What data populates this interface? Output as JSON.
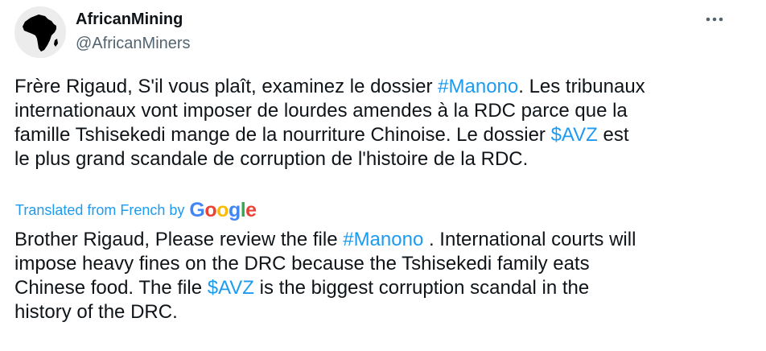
{
  "author": {
    "display_name": "AfricanMining",
    "handle": "@AfricanMiners",
    "avatar_icon": "africa-map-icon"
  },
  "more_menu_icon": "more-options-icon",
  "tweet": {
    "lines": [
      [
        {
          "text": "Frère Rigaud, S'il vous plaît, examinez le dossier ",
          "link": false
        },
        {
          "text": "#Manono",
          "link": true
        },
        {
          "text": ". Les tribunaux",
          "link": false
        }
      ],
      [
        {
          "text": "internationaux vont imposer de lourdes amendes à la RDC parce que la",
          "link": false
        }
      ],
      [
        {
          "text": "famille Tshisekedi mange de la nourriture Chinoise. Le dossier ",
          "link": false
        },
        {
          "text": "$AVZ",
          "link": true
        },
        {
          "text": " est",
          "link": false
        }
      ],
      [
        {
          "text": "le plus grand scandale de corruption de l'histoire de la RDC.",
          "link": false
        }
      ]
    ]
  },
  "translation_note": {
    "label": "Translated from French by",
    "provider": "Google",
    "provider_colors": [
      "#4285F4",
      "#EA4335",
      "#FBBC05",
      "#4285F4",
      "#34A853",
      "#EA4335"
    ]
  },
  "translation": {
    "lines": [
      [
        {
          "text": "Brother Rigaud, Please review the file ",
          "link": false
        },
        {
          "text": "#Manono",
          "link": true
        },
        {
          "text": " . International courts will",
          "link": false
        }
      ],
      [
        {
          "text": "impose heavy fines on the DRC because the Tshisekedi family eats",
          "link": false
        }
      ],
      [
        {
          "text": "Chinese food. The file ",
          "link": false
        },
        {
          "text": "$AVZ",
          "link": true
        },
        {
          "text": " is the biggest corruption scandal in the",
          "link": false
        }
      ],
      [
        {
          "text": "history of the DRC.",
          "link": false
        }
      ]
    ]
  },
  "colors": {
    "text": "#0f1419",
    "secondary": "#536471",
    "link": "#1d9bf0"
  }
}
